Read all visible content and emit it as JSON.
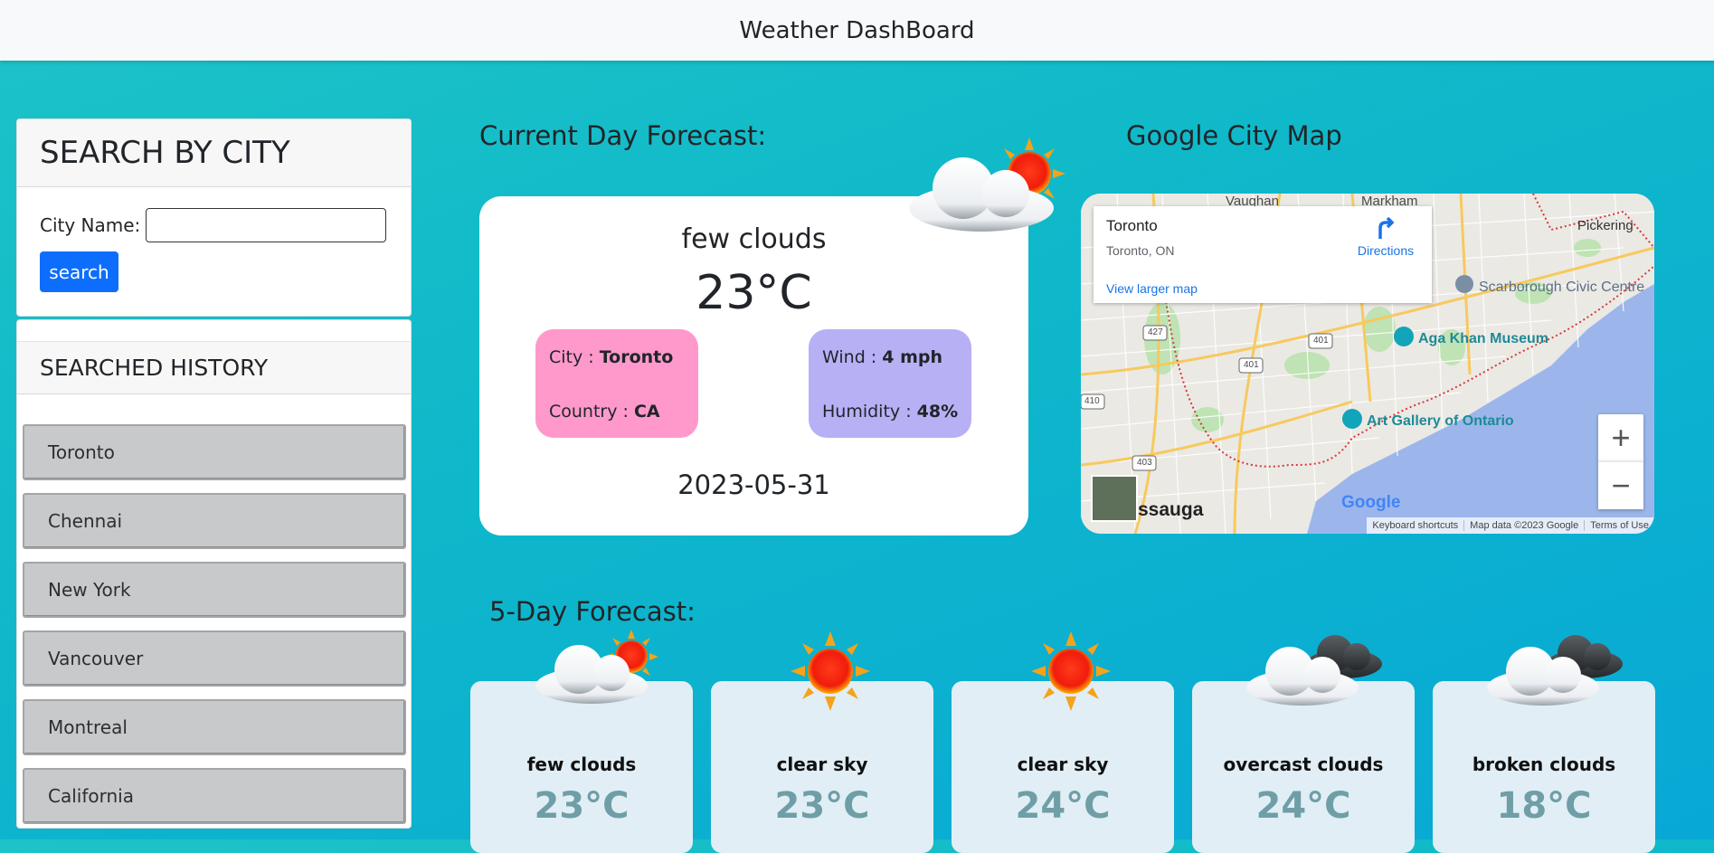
{
  "navbar": {
    "title": "Weather DashBoard"
  },
  "search": {
    "heading": "SEARCH BY CITY",
    "label": "City Name:",
    "value": "",
    "placeholder": "",
    "button": "search"
  },
  "history": {
    "heading": "SEARCHED HISTORY",
    "items": [
      "Toronto",
      "Chennai",
      "New York",
      "Vancouver",
      "Montreal",
      "California"
    ]
  },
  "current": {
    "heading": "Current Day Forecast:",
    "description": "few clouds",
    "temperature": "23°C",
    "city_label": "City : ",
    "city": "Toronto",
    "country_label": "Country : ",
    "country": "CA",
    "wind_label": "Wind : ",
    "wind": "4 mph",
    "humidity_label": "Humidity : ",
    "humidity": "48%",
    "date": "2023-05-31",
    "icon": "few-clouds-icon"
  },
  "map": {
    "heading": "Google City Map",
    "place_name": "Toronto",
    "place_address": "Toronto, ON",
    "directions": "Directions",
    "larger_map": "View larger map",
    "zoom_in": "+",
    "zoom_out": "−",
    "logo": "Google",
    "footer": [
      "Keyboard shortcuts",
      "Map data ©2023 Google",
      "Terms of Use"
    ],
    "labels": {
      "pickering": "Pickering",
      "vaughan": "Vaughan",
      "markham": "Markham",
      "scarborough": "Scarborough Civic Centre",
      "agakhan": "Aga Khan Museum",
      "ago": "Art Gallery of Ontario",
      "mississauga": "ssauga",
      "r427": "427",
      "r401a": "401",
      "r401b": "401",
      "r410": "410",
      "r403": "403"
    }
  },
  "forecast": {
    "heading": "5-Day Forecast:",
    "days": [
      {
        "description": "few clouds",
        "temperature": "23°C",
        "icon": "few-clouds-icon"
      },
      {
        "description": "clear sky",
        "temperature": "23°C",
        "icon": "sun-icon"
      },
      {
        "description": "clear sky",
        "temperature": "24°C",
        "icon": "sun-icon"
      },
      {
        "description": "overcast clouds",
        "temperature": "24°C",
        "icon": "overcast-clouds-icon"
      },
      {
        "description": "broken clouds",
        "temperature": "18°C",
        "icon": "broken-clouds-icon"
      }
    ]
  }
}
